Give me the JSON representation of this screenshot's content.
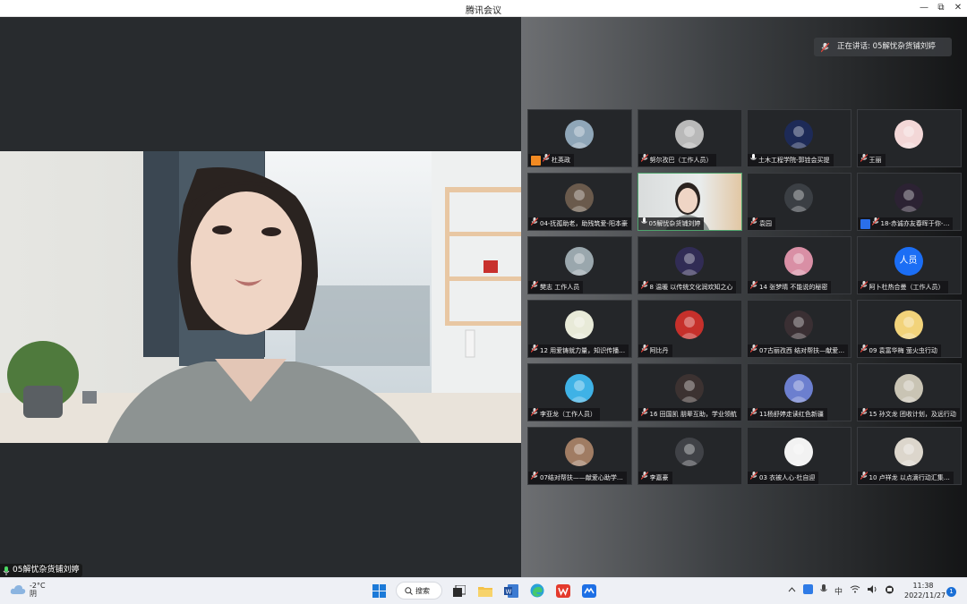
{
  "window": {
    "title": "腾讯会议",
    "minimize": "—",
    "restore": "⧉",
    "close": "✕"
  },
  "active_speaker": {
    "prefix": "正在讲话: ",
    "name": "05解忧杂货铺刘婷"
  },
  "main_video": {
    "name_tag": "05解忧杂货铺刘婷"
  },
  "participants": [
    {
      "name": "杜英政",
      "avatar": "photo",
      "badge": "host-orange",
      "mic": "muted"
    },
    {
      "name": "努尔孜巴（工作人员）",
      "avatar": "photo",
      "mic": "muted"
    },
    {
      "name": "土木工程学院-郭铨会买提",
      "avatar": "photo",
      "mic": "on"
    },
    {
      "name": "王丽",
      "avatar": "photo",
      "mic": "muted"
    },
    {
      "name": "04-抚孤助老，助残筑爱-阳本豪",
      "avatar": "photo",
      "mic": "muted"
    },
    {
      "name": "05解忧杂货铺刘婷",
      "avatar": "video",
      "mic": "on",
      "active": true
    },
    {
      "name": "袁园",
      "avatar": "photo",
      "mic": "muted"
    },
    {
      "name": "18-赤诚亦友春晖于你-…",
      "avatar": "photo",
      "badge": "host-blue",
      "mic": "muted"
    },
    {
      "name": "樊志 工作人员",
      "avatar": "photo",
      "mic": "muted"
    },
    {
      "name": "8 温暖 以传统文化润欢知之心",
      "avatar": "photo",
      "mic": "muted"
    },
    {
      "name": "14 张梦晴 不能说的秘密",
      "avatar": "photo",
      "mic": "muted"
    },
    {
      "name": "阿卜杜热合曼（工作人员）",
      "avatar": "text",
      "avatar_text": "人员",
      "mic": "muted"
    },
    {
      "name": "12 用爱铸就力量，知识传播…",
      "avatar": "photo",
      "mic": "muted"
    },
    {
      "name": "阿比丹",
      "avatar": "photo",
      "mic": "muted"
    },
    {
      "name": "07古丽孜西 结对帮扶—献爱…",
      "avatar": "photo",
      "mic": "muted"
    },
    {
      "name": "09 袁富华梅 萤火虫行动",
      "avatar": "photo",
      "mic": "muted"
    },
    {
      "name": "李亚龙（工作人员）",
      "avatar": "photo",
      "mic": "muted"
    },
    {
      "name": "16 田国凯 朋辈互助，学业领航",
      "avatar": "photo",
      "mic": "muted"
    },
    {
      "name": "11杨舒婷走读红色新疆",
      "avatar": "photo",
      "mic": "muted"
    },
    {
      "name": "15 孙文龙 团收计划，及远行动",
      "avatar": "photo",
      "mic": "muted"
    },
    {
      "name": "07结对帮扶——献爱心助学…",
      "avatar": "photo",
      "mic": "muted"
    },
    {
      "name": "李嘉豪",
      "avatar": "photo",
      "mic": "muted"
    },
    {
      "name": "03 衣被人心·杜自迎",
      "avatar": "photo",
      "mic": "muted"
    },
    {
      "name": "10 卢祥龙 以点滴行动汇集…",
      "avatar": "photo",
      "mic": "muted"
    }
  ],
  "avatar_colors": [
    "#8fa6b8",
    "#b9b9b9",
    "#1d2a57",
    "#f3d7d7",
    "#6a5a4c",
    "#8f9aa0",
    "#3b3f44",
    "#2c2233",
    "#9aa7ad",
    "#312c55",
    "#d98fa5",
    "#1b6ef5",
    "#e8ead8",
    "#c6302b",
    "#3a2f33",
    "#f2d37a",
    "#3fb2e6",
    "#3c3231",
    "#6c7fcf",
    "#c9c4b4",
    "#a07c63",
    "#404247",
    "#f2f2f2",
    "#dcd6cc"
  ],
  "taskbar": {
    "weather_temp": "-2°C",
    "weather_desc": "阴",
    "search_label": "搜索",
    "time": "11:38",
    "date": "2022/11/27",
    "ime": "中",
    "notifications": "1"
  }
}
